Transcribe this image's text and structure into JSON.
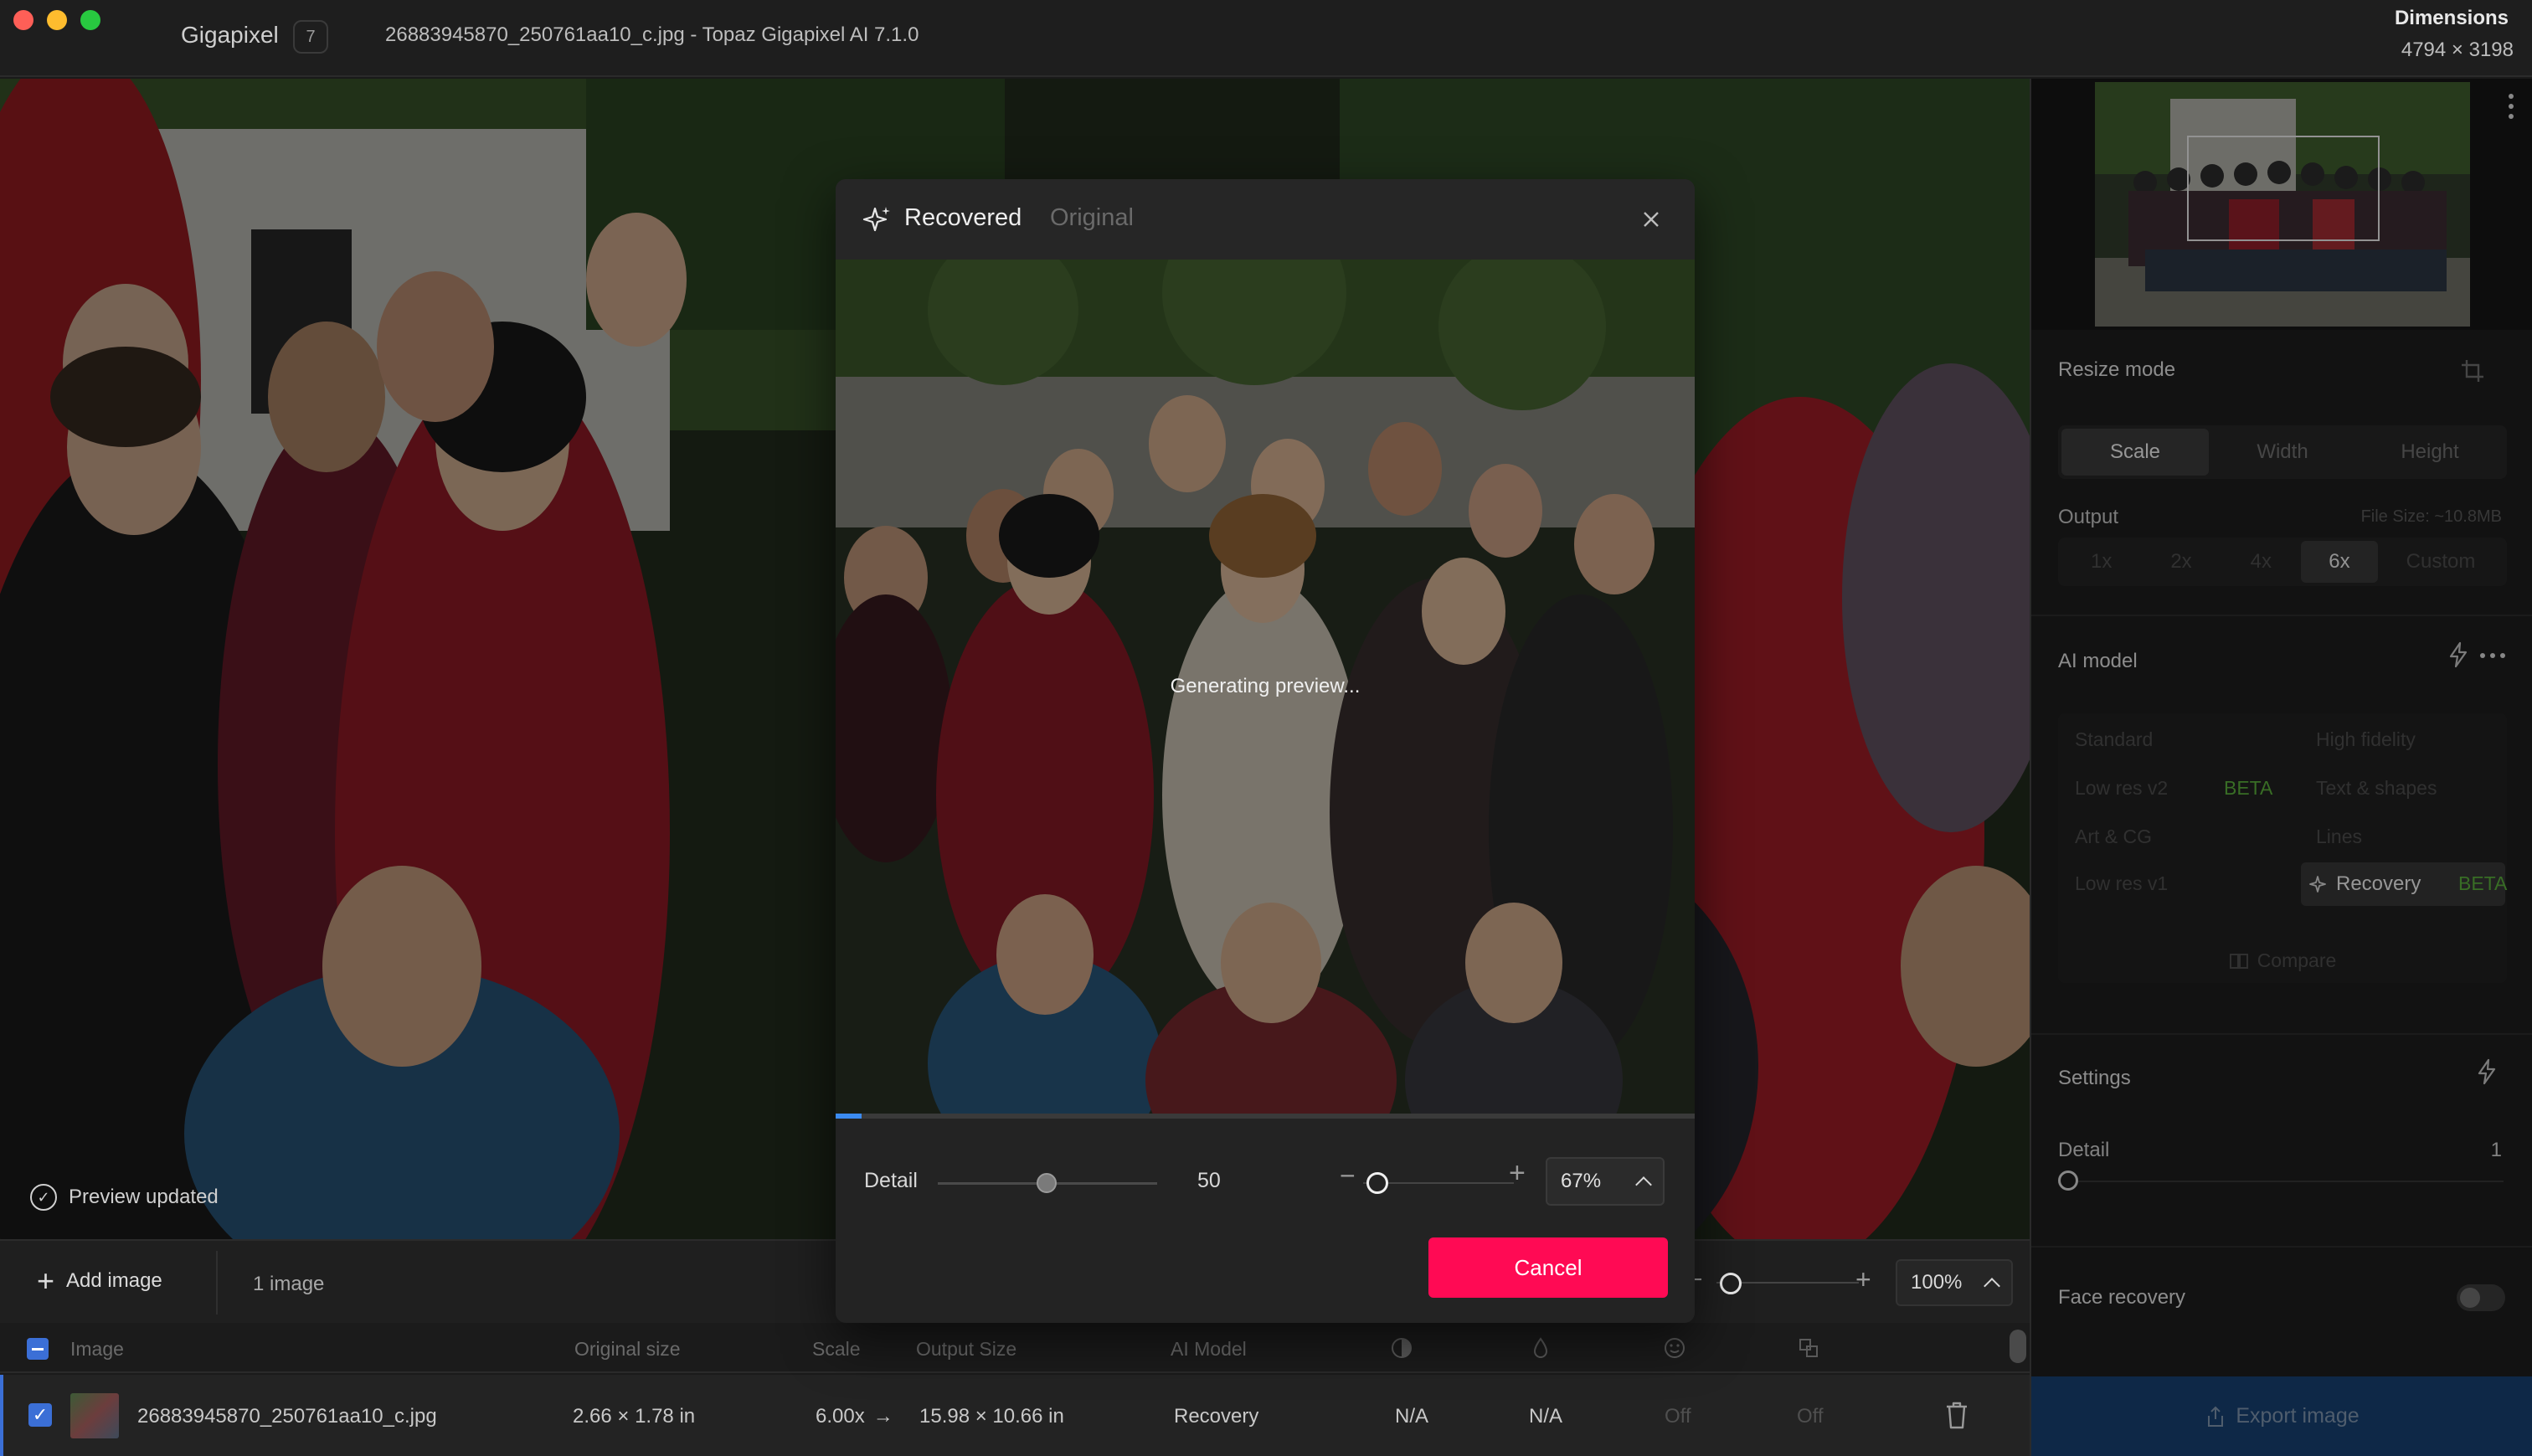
{
  "titlebar": {
    "app_name": "Gigapixel",
    "app_badge": "7",
    "window_title": "26883945870_250761aa10_c.jpg - Topaz Gigapixel AI 7.1.0",
    "dimensions_label": "Dimensions",
    "dimensions_value": "4794 × 3198"
  },
  "canvas": {
    "preview_status": "Preview updated"
  },
  "bottombar": {
    "add_image": "Add image",
    "image_count": "1 image",
    "zoom_minus": "−",
    "zoom_plus": "+",
    "zoom": "100%"
  },
  "table": {
    "headers": {
      "image": "Image",
      "original_size": "Original size",
      "scale": "Scale",
      "output_size": "Output Size",
      "ai_model": "AI Model"
    },
    "row": {
      "filename": "26883945870_250761aa10_c.jpg",
      "original_size": "2.66 × 1.78 in",
      "scale": "6.00x",
      "arrow": "→",
      "output_size": "15.98 × 10.66 in",
      "ai_model": "Recovery",
      "col1": "N/A",
      "col2": "N/A",
      "col3": "Off",
      "col4": "Off"
    }
  },
  "sidebar": {
    "resize_mode": {
      "title": "Resize mode",
      "options": [
        "Scale",
        "Width",
        "Height"
      ],
      "selected": "Scale"
    },
    "output": {
      "label": "Output",
      "file_size": "File Size: ~10.8MB",
      "options": [
        "1x",
        "2x",
        "4x",
        "6x",
        "Custom"
      ],
      "selected": "6x"
    },
    "ai_model": {
      "title": "AI model",
      "standard": "Standard",
      "high_fidelity": "High fidelity",
      "low_res_v2": "Low res v2",
      "beta_1": "BETA",
      "text_shapes": "Text & shapes",
      "art_cg": "Art & CG",
      "lines": "Lines",
      "low_res_v1": "Low res v1",
      "recovery": "Recovery",
      "beta_2": "BETA",
      "compare": "Compare"
    },
    "settings": {
      "title": "Settings",
      "detail_label": "Detail",
      "detail_value": "1"
    },
    "face_recovery": {
      "label": "Face recovery"
    },
    "export_label": "Export image"
  },
  "modal": {
    "tab_recovered": "Recovered",
    "tab_original": "Original",
    "generating": "Generating preview...",
    "progress": 0.03,
    "detail_label": "Detail",
    "detail_value": "50",
    "zoom_minus": "−",
    "zoom_plus": "+",
    "zoom": "67%",
    "cancel": "Cancel"
  },
  "colors": {
    "accent_blue": "#3b6fd6",
    "cancel_pink": "#ff0a54",
    "beta_green": "#57a83a",
    "export_blue": "#163e6e"
  }
}
